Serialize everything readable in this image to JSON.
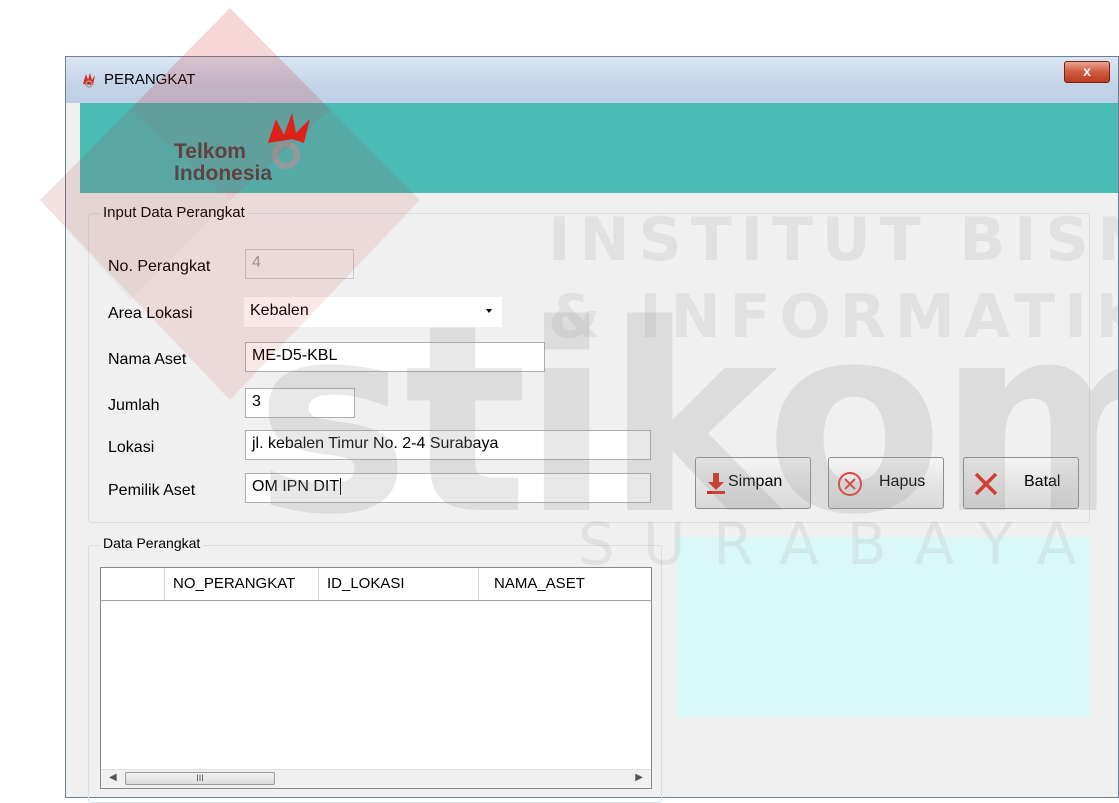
{
  "window": {
    "title": "PERANGKAT",
    "close_label": "x"
  },
  "banner": {
    "logo_line1": "Telkom",
    "logo_line2": "Indonesia"
  },
  "watermark": {
    "line1": "INSTITUT BISNIS",
    "line2": "& INFORMATIKA",
    "line3": "stikom",
    "line4": "SURABAYA"
  },
  "input_group": {
    "legend": "Input Data Perangkat",
    "fields": {
      "no_perangkat": {
        "label": "No. Perangkat",
        "value": "4"
      },
      "area_lokasi": {
        "label": "Area Lokasi",
        "value": "Kebalen"
      },
      "nama_aset": {
        "label": "Nama Aset",
        "value": "ME-D5-KBL"
      },
      "jumlah": {
        "label": "Jumlah",
        "value": "3"
      },
      "lokasi": {
        "label": "Lokasi",
        "value": "jl. kebalen Timur No. 2-4 Surabaya"
      },
      "pemilik_aset": {
        "label": "Pemilik Aset",
        "value": "OM IPN DIT"
      }
    }
  },
  "buttons": {
    "simpan": "Simpan",
    "hapus": "Hapus",
    "batal": "Batal"
  },
  "data_group": {
    "legend": "Data Perangkat",
    "columns": [
      "",
      "NO_PERANGKAT",
      "ID_LOKASI",
      "NAMA_ASET"
    ],
    "scroll_thumb": "III"
  },
  "colors": {
    "banner": "#4bbbb6",
    "cyan_panel": "#dbf8f8",
    "logo_red": "#e2231a"
  }
}
